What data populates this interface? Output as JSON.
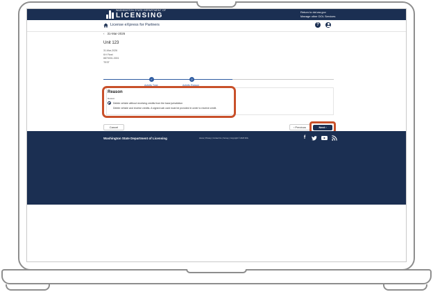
{
  "header": {
    "logo_small": "WASHINGTON STATE DEPARTMENT OF",
    "logo_big": "LICENSING",
    "link_return": "Return to dol.wa.gov",
    "link_manage": "Manage other DOL Services"
  },
  "appbar": {
    "title": "License eXpress for Partners",
    "help_glyph": "?"
  },
  "page": {
    "back_date": "31-Mar-2026",
    "unit_title": "Unit 123",
    "meta_lines": [
      "31-Mar-2026",
      "KH Fleet",
      "8870001-0001",
      "TEST"
    ]
  },
  "stepper": {
    "steps": [
      {
        "label": "Activity Type",
        "state": "complete",
        "glyph": "✓"
      },
      {
        "label": "Activity Reason",
        "state": "current",
        "glyph": "2"
      }
    ]
  },
  "reason": {
    "title": "Reason",
    "field_label": "Reason",
    "options": [
      {
        "text": "Delete vehicle without receiving credits from the base jurisdiction",
        "selected": true
      },
      {
        "text": "Delete vehicle and receive credits. A signed cab card must be provided in order to receive credit.",
        "selected": false
      }
    ]
  },
  "actions": {
    "cancel": "Cancel",
    "previous": "‹  Previous",
    "next": "Next  ›"
  },
  "footer": {
    "org": "Washington State Department of Licensing",
    "links": "Home | Privacy | Contact Us | Survey | Copyright © 2026 DOL"
  },
  "colors": {
    "navy": "#1b2f52",
    "accent_blue": "#2c5aa0",
    "highlight": "#c8502a"
  }
}
